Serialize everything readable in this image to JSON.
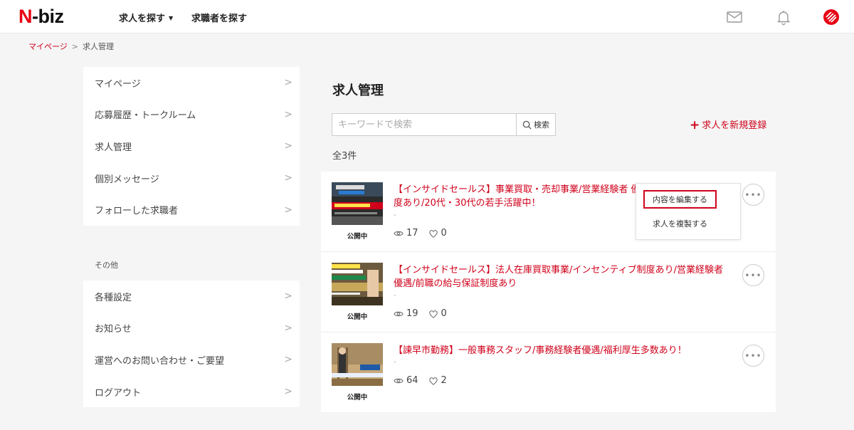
{
  "header": {
    "logo_prefix": "N",
    "logo_rest": "-biz",
    "nav": [
      {
        "label": "求人を探す"
      },
      {
        "label": "求職者を探す"
      }
    ]
  },
  "breadcrumb": {
    "home": "マイページ",
    "current": "求人管理"
  },
  "sidebar": {
    "main_items": [
      {
        "label": "マイページ"
      },
      {
        "label": "応募履歴・トークルーム"
      },
      {
        "label": "求人管理"
      },
      {
        "label": "個別メッセージ"
      },
      {
        "label": "フォローした求職者"
      }
    ],
    "section_label": "その他",
    "other_items": [
      {
        "label": "各種設定"
      },
      {
        "label": "お知らせ"
      },
      {
        "label": "運営へのお問い合わせ・ご要望"
      },
      {
        "label": "ログアウト"
      }
    ]
  },
  "main": {
    "title": "求人管理",
    "search": {
      "placeholder": "キーワードで検索",
      "value": "",
      "button": "検索"
    },
    "new_job": "求人を新規登録",
    "total": "全3件",
    "jobs": [
      {
        "title": "【インサイドセールス】事業買取・売却事業/営業経験者 優遇/インセンティブ制度あり/20代・30代の若手活躍中！",
        "title_visible": "【インサイドセールス】事業買取・売却事業/営業経験者 優",
        "title_line2": "度あり/20代・30代の若手活躍中！",
        "sub": "-",
        "status": "公開中",
        "views": "17",
        "likes": "0"
      },
      {
        "title": "【インサイドセールス】法人在庫買取事業/インセンティブ制度あり/営業経験者優遇/前職の給与保証制度あり",
        "sub": "-",
        "status": "公開中",
        "views": "19",
        "likes": "0"
      },
      {
        "title": "【諫早市勤務】一般事務スタッフ/事務経験者優遇/福利厚生多数あり！",
        "sub": "-",
        "status": "公開中",
        "views": "64",
        "likes": "2"
      }
    ],
    "dropdown": {
      "edit": "内容を編集する",
      "duplicate": "求人を複製する"
    }
  },
  "colors": {
    "accent": "#d0021b",
    "background": "#f5f5f5"
  }
}
